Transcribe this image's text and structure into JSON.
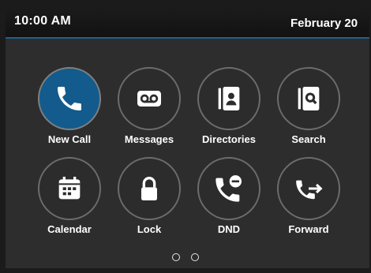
{
  "status_bar": {
    "time": "10:00 AM",
    "date": "February 20"
  },
  "colors": {
    "accent": "#1d5f8c",
    "active_button": "#125b8c",
    "screen_background": "#2d2d2d"
  },
  "apps": [
    {
      "label": "New Call",
      "icon": "phone-icon",
      "active": true
    },
    {
      "label": "Messages",
      "icon": "voicemail-icon",
      "active": false
    },
    {
      "label": "Directories",
      "icon": "contacts-book-icon",
      "active": false
    },
    {
      "label": "Search",
      "icon": "search-directory-icon",
      "active": false
    },
    {
      "label": "Calendar",
      "icon": "calendar-icon",
      "active": false
    },
    {
      "label": "Lock",
      "icon": "lock-icon",
      "active": false
    },
    {
      "label": "DND",
      "icon": "do-not-disturb-icon",
      "active": false
    },
    {
      "label": "Forward",
      "icon": "call-forward-icon",
      "active": false
    }
  ],
  "pager": {
    "pages": 2,
    "current": 1
  }
}
